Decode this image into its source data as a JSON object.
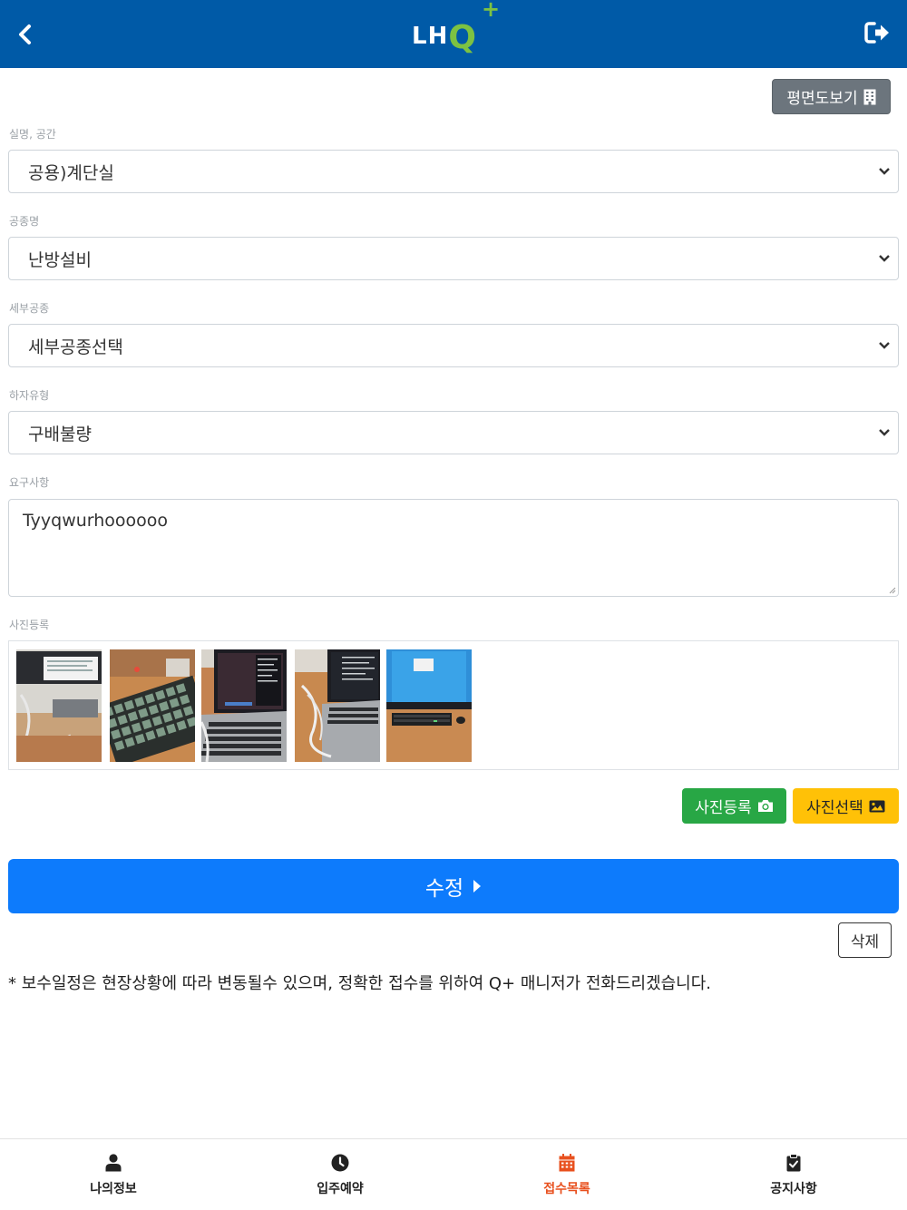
{
  "header": {
    "logo_text": "LHQ+",
    "back_icon": "chevron-left-icon",
    "logout_icon": "sign-out-icon"
  },
  "plan_button": {
    "label": "평면도보기",
    "icon": "building-icon"
  },
  "form": {
    "room": {
      "label": "실명, 공간",
      "value": "공용)계단실"
    },
    "trade": {
      "label": "공종명",
      "value": "난방설비"
    },
    "subtrade": {
      "label": "세부공종",
      "value": "세부공종선택"
    },
    "defect_type": {
      "label": "하자유형",
      "value": "구배불량"
    },
    "request": {
      "label": "요구사항",
      "value": "Tyyqwurhoooooo"
    },
    "photos": {
      "label": "사진등록"
    }
  },
  "photo_buttons": {
    "register_label": "사진등록",
    "register_icon": "camera-icon",
    "select_label": "사진선택",
    "select_icon": "image-icon"
  },
  "submit": {
    "label": "수정",
    "icon": "caret-right-icon"
  },
  "delete": {
    "label": "삭제"
  },
  "notice": "* 보수일정은 현장상황에 따라 변동될수 있으며, 정확한 접수를 위하여 Q+ 매니저가 전화드리겠습니다.",
  "bottom_nav": [
    {
      "label": "나의정보",
      "icon": "user-icon"
    },
    {
      "label": "입주예약",
      "icon": "clock-icon"
    },
    {
      "label": "접수목록",
      "icon": "calendar-icon",
      "active": true
    },
    {
      "label": "공지사항",
      "icon": "clipboard-check-icon"
    }
  ],
  "colors": {
    "header_bg": "#005aa7",
    "logo_accent": "#7cc242",
    "submit_bg": "#0d7bfc",
    "register_bg": "#28a745",
    "select_bg": "#ffc107",
    "active_nav": "#e8501e"
  }
}
